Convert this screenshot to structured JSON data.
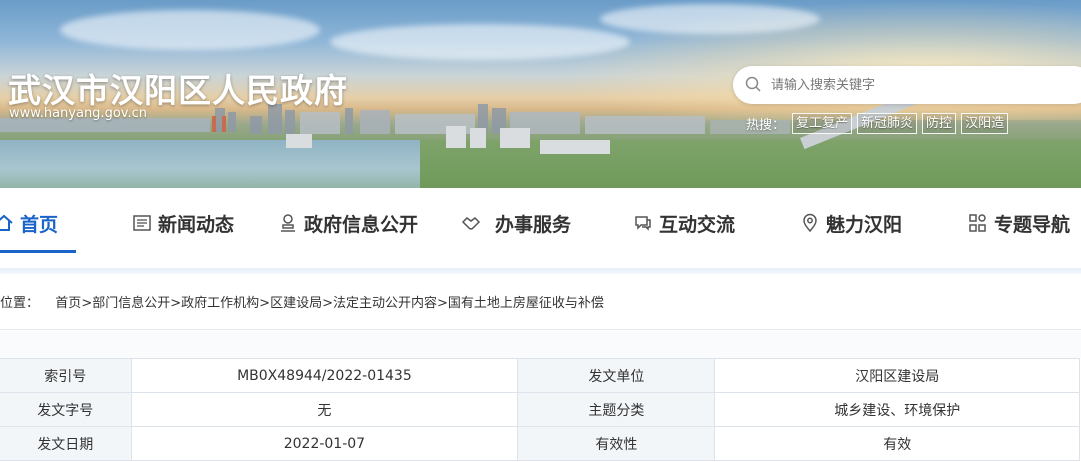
{
  "header": {
    "site_title": "武汉市汉阳区人民政府",
    "site_url": "www.hanyang.gov.cn",
    "search": {
      "placeholder": "请输入搜索关键字"
    },
    "hot_label": "热搜：",
    "hot_tags": [
      "复工复产",
      "新冠肺炎",
      "防控",
      "汉阳造"
    ]
  },
  "nav": {
    "items": [
      {
        "label": "首页",
        "icon": "home-icon"
      },
      {
        "label": "新闻动态",
        "icon": "news-icon"
      },
      {
        "label": "政府信息公开",
        "icon": "user-stamp-icon"
      },
      {
        "label": "办事服务",
        "icon": "handshake-icon"
      },
      {
        "label": "互动交流",
        "icon": "chat-icon"
      },
      {
        "label": "魅力汉阳",
        "icon": "location-icon"
      },
      {
        "label": "专题导航",
        "icon": "grid-icon"
      }
    ],
    "active_index": 0
  },
  "breadcrumb": {
    "label": "位置：",
    "items": [
      "首页",
      "部门信息公开",
      "政府工作机构",
      "区建设局",
      "法定主动公开内容",
      "国有土地上房屋征收与补偿"
    ],
    "separator": ">"
  },
  "info_table": {
    "rows": [
      {
        "k1": "索引号",
        "v1": "MB0X48944/2022-01435",
        "k2": "发文单位",
        "v2": "汉阳区建设局"
      },
      {
        "k1": "发文字号",
        "v1": "无",
        "k2": "主题分类",
        "v2": "城乡建设、环境保护"
      },
      {
        "k1": "发文日期",
        "v1": "2022-01-07",
        "k2": "有效性",
        "v2": "有效"
      }
    ]
  },
  "colors": {
    "accent": "#1a63c8",
    "text": "#333333",
    "table_key_bg": "#f3f6f9"
  }
}
